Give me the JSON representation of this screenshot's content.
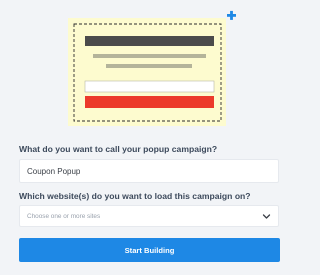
{
  "illustration": {
    "icons": [
      "popup-illustration",
      "plus-icon"
    ],
    "colors": {
      "card_bg": "#fdfbcf",
      "dashed_border": "#2b2b2b",
      "heading_bar": "#4b4b4b",
      "text_lines": "#b4b49a",
      "input_box": "#ffffff",
      "button_bar": "#ec3a2b",
      "plus": "#1e88e5"
    }
  },
  "form": {
    "campaign_name_label": "What do you want to call your popup campaign?",
    "campaign_name_value": "Coupon Popup",
    "website_label": "Which website(s) do you want to load this campaign on?",
    "website_placeholder": "Choose one or more sites",
    "submit_label": "Start Building"
  },
  "colors": {
    "accent": "#1e88e5",
    "page_bg": "#f2f4f7",
    "label_text": "#3d4a5c"
  }
}
